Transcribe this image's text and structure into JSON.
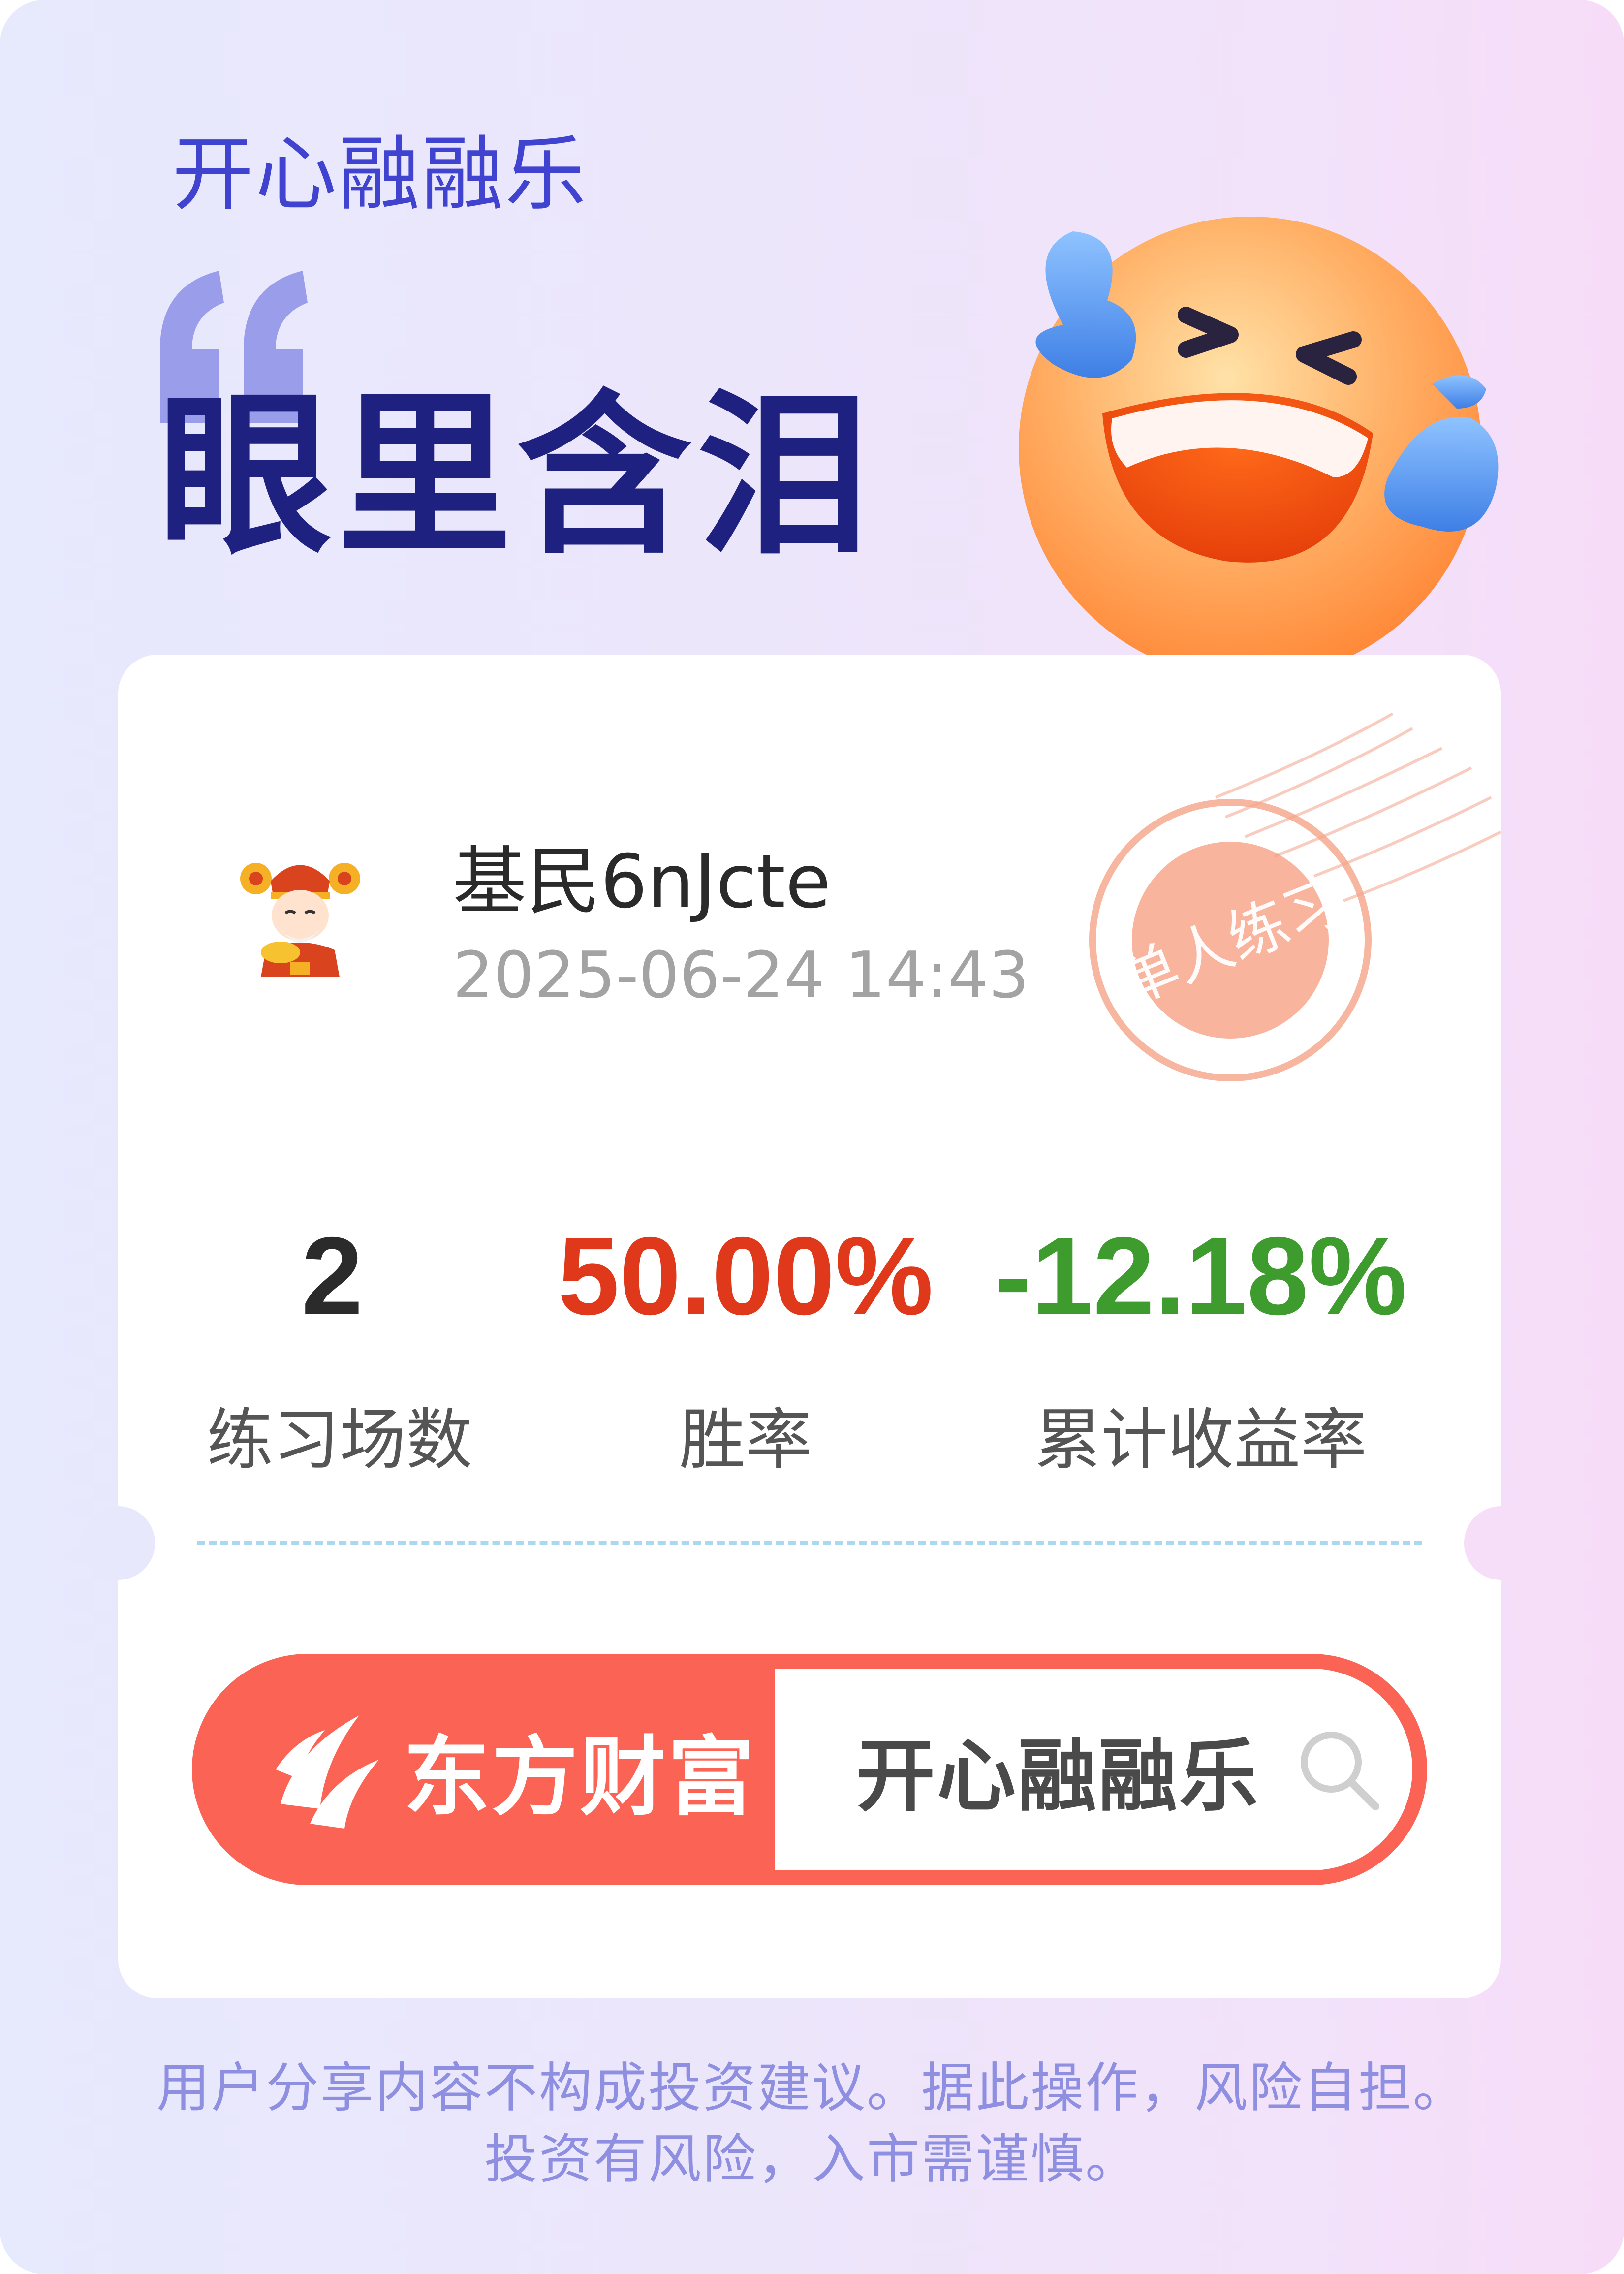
{
  "brand": {
    "title": "开心融融乐"
  },
  "headline": {
    "text": "眼里含泪",
    "emoji_icon": "laughing-crying-emoji"
  },
  "card": {
    "user": {
      "name": "基民6nJcte",
      "timestamp": "2025-06-24 14:43",
      "avatar_icon": "fortune-god-avatar"
    },
    "stamp": {
      "text": "单人练习"
    },
    "stats": [
      {
        "value": "2",
        "label": "练习场数",
        "color": "#2b2b2b"
      },
      {
        "value": "50.00%",
        "label": "胜率",
        "color": "#e0381a"
      },
      {
        "value": "-12.18%",
        "label": "累计收益率",
        "color": "#3e9b2e"
      }
    ]
  },
  "search_bar": {
    "brand": "东方财富",
    "query": "开心融融乐",
    "logo_icon": "eastmoney-logo-icon",
    "search_icon": "search-icon",
    "accent_color": "#fb6454"
  },
  "footer": {
    "line1": "用户分享内容不构成投资建议。据此操作，风险自担。",
    "line2": "投资有风险，入市需谨慎。"
  }
}
